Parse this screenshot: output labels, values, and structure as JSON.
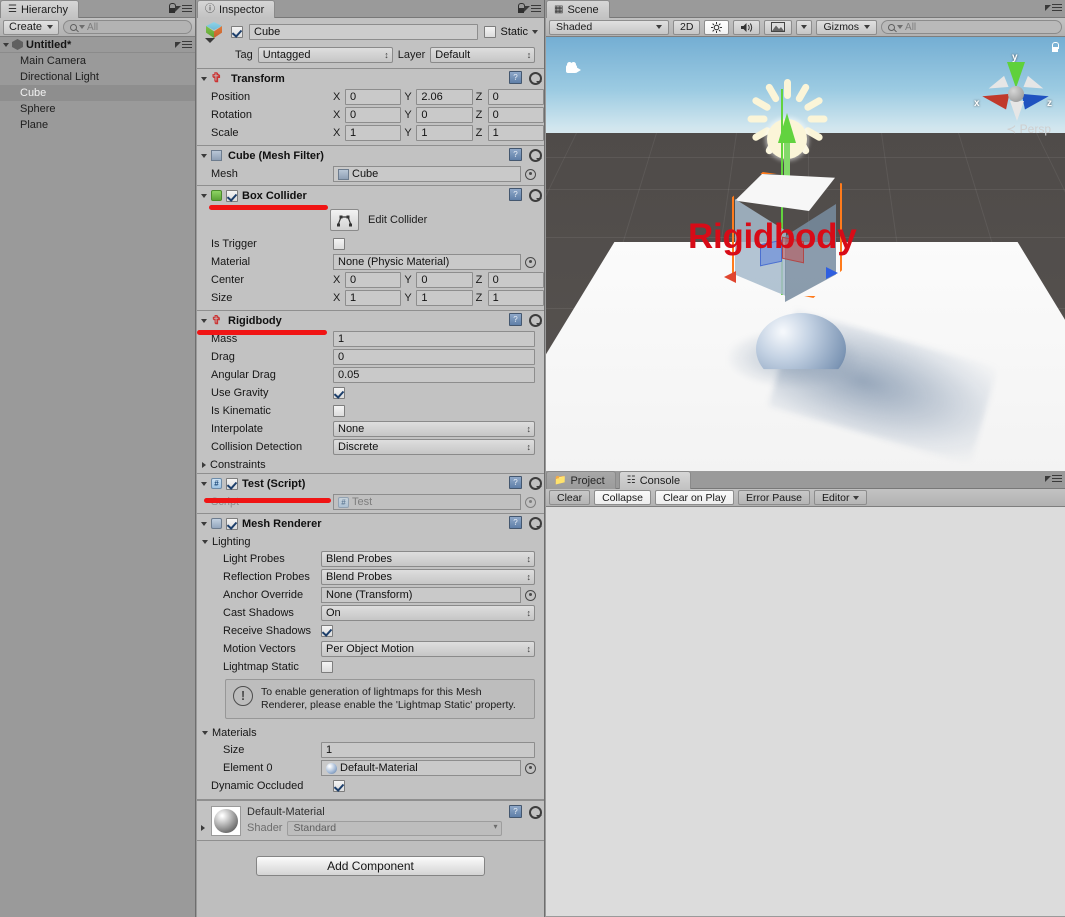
{
  "hierarchy": {
    "tab_label": "Hierarchy",
    "tab_icon": "hierarchy-icon",
    "create_label": "Create",
    "search_placeholder": "All",
    "scene_root": "Untitled*",
    "items": [
      {
        "label": "Main Camera",
        "selected": false
      },
      {
        "label": "Directional Light",
        "selected": false
      },
      {
        "label": "Cube",
        "selected": true
      },
      {
        "label": "Sphere",
        "selected": false
      },
      {
        "label": "Plane",
        "selected": false
      }
    ]
  },
  "inspector": {
    "tab_label": "Inspector",
    "object": {
      "enabled": true,
      "name": "Cube",
      "static_label": "Static",
      "static_checked": false,
      "tag_label": "Tag",
      "tag_value": "Untagged",
      "layer_label": "Layer",
      "layer_value": "Default"
    },
    "transform": {
      "title": "Transform",
      "rows": [
        {
          "name": "Position",
          "x": "0",
          "y": "2.06",
          "z": "0"
        },
        {
          "name": "Rotation",
          "x": "0",
          "y": "0",
          "z": "0"
        },
        {
          "name": "Scale",
          "x": "1",
          "y": "1",
          "z": "1"
        }
      ],
      "axis_labels": [
        "X",
        "Y",
        "Z"
      ]
    },
    "mesh_filter": {
      "title": "Cube (Mesh Filter)",
      "mesh_label": "Mesh",
      "mesh_value": "Cube"
    },
    "box_collider": {
      "title": "Box Collider",
      "enabled": true,
      "edit_collider_label": "Edit Collider",
      "is_trigger_label": "Is Trigger",
      "is_trigger_checked": false,
      "material_label": "Material",
      "material_value": "None (Physic Material)",
      "center_label": "Center",
      "center": {
        "x": "0",
        "y": "0",
        "z": "0"
      },
      "size_label": "Size",
      "size": {
        "x": "1",
        "y": "1",
        "z": "1"
      },
      "annotation_color": "#f01414"
    },
    "rigidbody": {
      "title": "Rigidbody",
      "mass_label": "Mass",
      "mass_value": "1",
      "drag_label": "Drag",
      "drag_value": "0",
      "angular_drag_label": "Angular Drag",
      "angular_drag_value": "0.05",
      "use_gravity_label": "Use Gravity",
      "use_gravity_checked": true,
      "is_kinematic_label": "Is Kinematic",
      "is_kinematic_checked": false,
      "interpolate_label": "Interpolate",
      "interpolate_value": "None",
      "collision_detection_label": "Collision Detection",
      "collision_detection_value": "Discrete",
      "constraints_label": "Constraints",
      "annotation_color": "#f01414"
    },
    "test_script": {
      "title": "Test (Script)",
      "enabled": true,
      "script_label": "Script",
      "script_value": "Test",
      "annotation_color": "#f01414"
    },
    "mesh_renderer": {
      "title": "Mesh Renderer",
      "enabled": true,
      "lighting_label": "Lighting",
      "light_probes_label": "Light Probes",
      "light_probes_value": "Blend Probes",
      "reflection_probes_label": "Reflection Probes",
      "reflection_probes_value": "Blend Probes",
      "anchor_override_label": "Anchor Override",
      "anchor_override_value": "None (Transform)",
      "cast_shadows_label": "Cast Shadows",
      "cast_shadows_value": "On",
      "receive_shadows_label": "Receive Shadows",
      "receive_shadows_checked": true,
      "motion_vectors_label": "Motion Vectors",
      "motion_vectors_value": "Per Object Motion",
      "lightmap_static_label": "Lightmap Static",
      "lightmap_static_checked": false,
      "help_text": "To enable generation of lightmaps for this Mesh Renderer, please enable the 'Lightmap Static' property.",
      "materials_label": "Materials",
      "size_label": "Size",
      "size_value": "1",
      "element0_label": "Element 0",
      "element0_value": "Default-Material",
      "dynamic_occluded_label": "Dynamic Occluded",
      "dynamic_occluded_checked": true
    },
    "material": {
      "name": "Default-Material",
      "shader_label": "Shader",
      "shader_value": "Standard"
    },
    "add_component_label": "Add Component"
  },
  "scene": {
    "tab_label": "Scene",
    "shading_mode": "Shaded",
    "mode_2d": "2D",
    "gizmos_label": "Gizmos",
    "search_placeholder": "All",
    "overlay_text": "Rigidbody",
    "overlay_color": "#d80b17",
    "projection_label": "Persp",
    "axis_labels": {
      "x": "x",
      "y": "y",
      "z": "z"
    }
  },
  "console": {
    "project_tab_label": "Project",
    "console_tab_label": "Console",
    "buttons": [
      {
        "label": "Clear",
        "active": false
      },
      {
        "label": "Collapse",
        "active": true
      },
      {
        "label": "Clear on Play",
        "active": true
      },
      {
        "label": "Error Pause",
        "active": false
      },
      {
        "label": "Editor",
        "active": false
      }
    ]
  }
}
